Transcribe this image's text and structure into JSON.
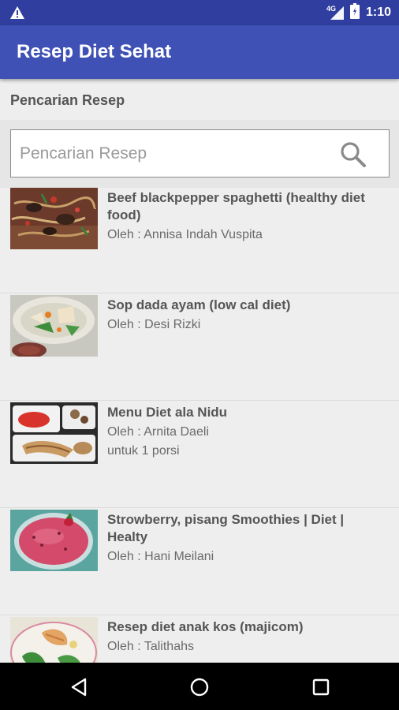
{
  "status_bar": {
    "network": "4G",
    "time": "1:10",
    "icons": [
      "warning-icon",
      "signal-icon",
      "battery-icon"
    ]
  },
  "app_bar": {
    "title": "Resep Diet Sehat"
  },
  "search": {
    "section_label": "Pencarian Resep",
    "placeholder": "Pencarian Resep",
    "value": ""
  },
  "recipes": [
    {
      "title": "Beef blackpepper spaghetti (healthy diet food)",
      "author": "Oleh : Annisa Indah Vuspita",
      "note": ""
    },
    {
      "title": "Sop dada ayam (low cal diet)",
      "author": "Oleh : Desi Rizki",
      "note": ""
    },
    {
      "title": "Menu Diet ala Nidu",
      "author": "Oleh : Arnita Daeli",
      "note": "untuk 1 porsi"
    },
    {
      "title": "Strowberry, pisang Smoothies | Diet | Healty",
      "author": "Oleh : Hani Meilani",
      "note": ""
    },
    {
      "title": "Resep diet anak kos (majicom)",
      "author": "Oleh : Talithahs",
      "note": ""
    }
  ],
  "colors": {
    "primary": "#3f51b5",
    "primary_dark": "#303f9f",
    "background": "#eeeeee"
  }
}
